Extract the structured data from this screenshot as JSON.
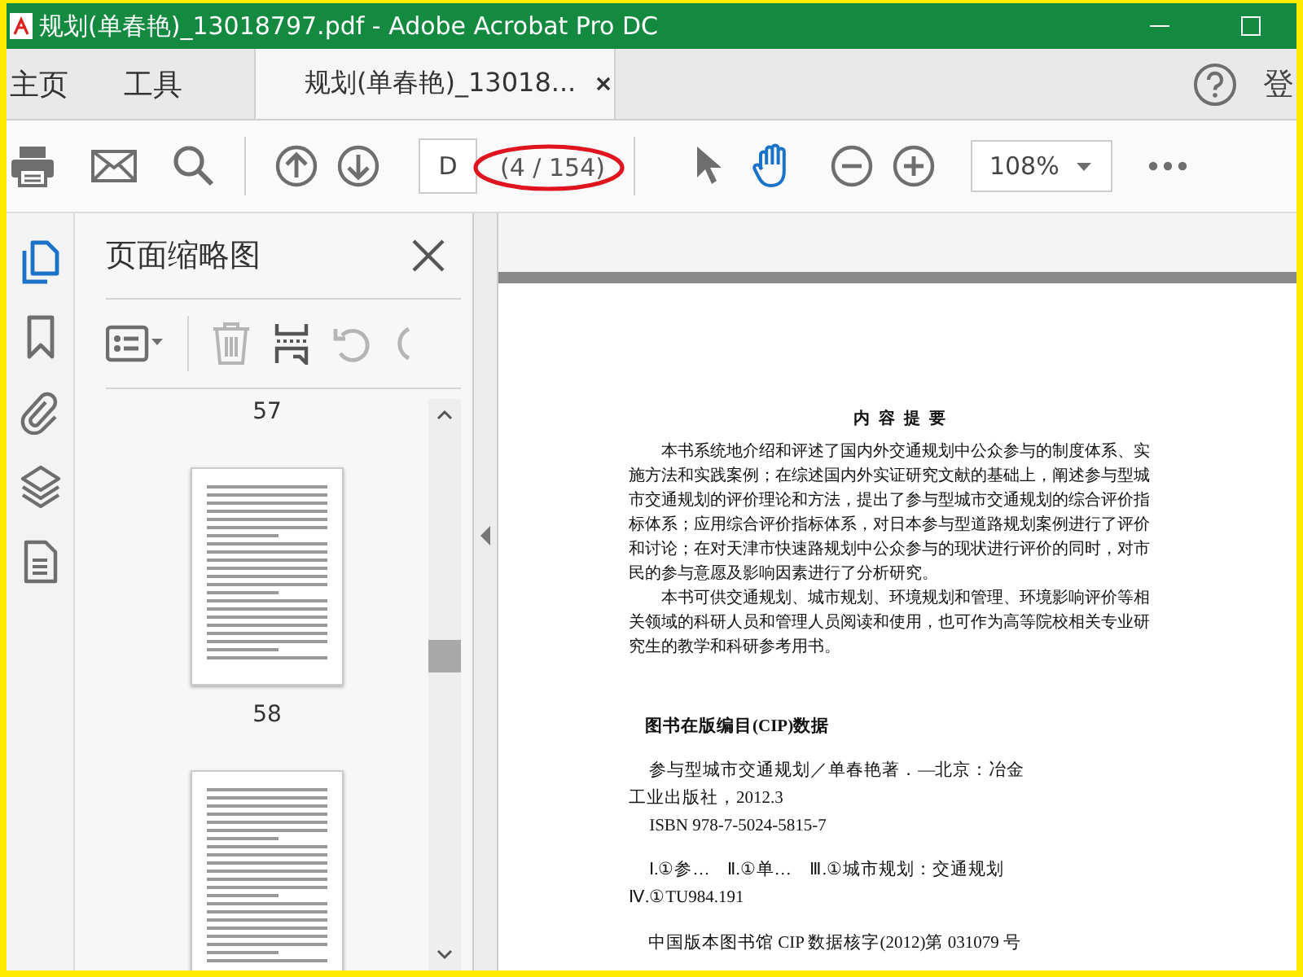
{
  "window": {
    "title": "规划(单春艳)_13018797.pdf - Adobe Acrobat Pro DC"
  },
  "nav_tabs": [
    {
      "label": "主页",
      "selected": false
    },
    {
      "label": "工具",
      "selected": false
    }
  ],
  "doc_tabs": [
    {
      "label": "规划(单春艳)_13018...",
      "selected": true
    }
  ],
  "sign_in": "登",
  "toolbar": {
    "page_field": "D",
    "page_count": "(4 / 154)",
    "zoom": "108%",
    "tools": [
      {
        "kind": "select",
        "selected": false
      },
      {
        "kind": "hand",
        "selected": true
      }
    ]
  },
  "left_rail": [
    {
      "kind": "pages",
      "selected": true
    },
    {
      "kind": "bookmark",
      "selected": false
    },
    {
      "kind": "attachment",
      "selected": false
    },
    {
      "kind": "layers",
      "selected": false
    },
    {
      "kind": "document",
      "selected": false
    }
  ],
  "thumbnails_panel": {
    "title": "页面缩略图",
    "pages": [
      {
        "label": "57"
      },
      {
        "label": "58"
      }
    ]
  },
  "document": {
    "heading": "内 容 提 要",
    "paragraphs": [
      "本书系统地介绍和评述了国内外交通规划中公众参与的制度体系、实施方法和实践案例；在综述国内外实证研究文献的基础上，阐述参与型城市交通规划的评价理论和方法，提出了参与型城市交通规划的综合评价指标体系；应用综合评价指标体系，对日本参与型道路规划案例进行了评价和讨论；在对天津市快速路规划中公众参与的现状进行评价的同时，对市民的参与意愿及影响因素进行了分析研究。",
      "本书可供交通规划、城市规划、环境规划和管理、环境影响评价等相关领域的科研人员和管理人员阅读和使用，也可作为高等院校相关专业研究生的教学和科研参考用书。"
    ],
    "cip_heading": "图书在版编目(CIP)数据",
    "cip_lines": [
      "参与型城市交通规划／单春艳著．—北京：冶金工业出版社，2012.3",
      "ISBN 978-7-5024-5815-7",
      "Ⅰ.①参…　Ⅱ.①单…　Ⅲ.①城市规划：交通规划Ⅳ.①TU984.191"
    ],
    "cip_number": "中国版本图书馆 CIP 数据核字(2012)第 031079 号"
  }
}
